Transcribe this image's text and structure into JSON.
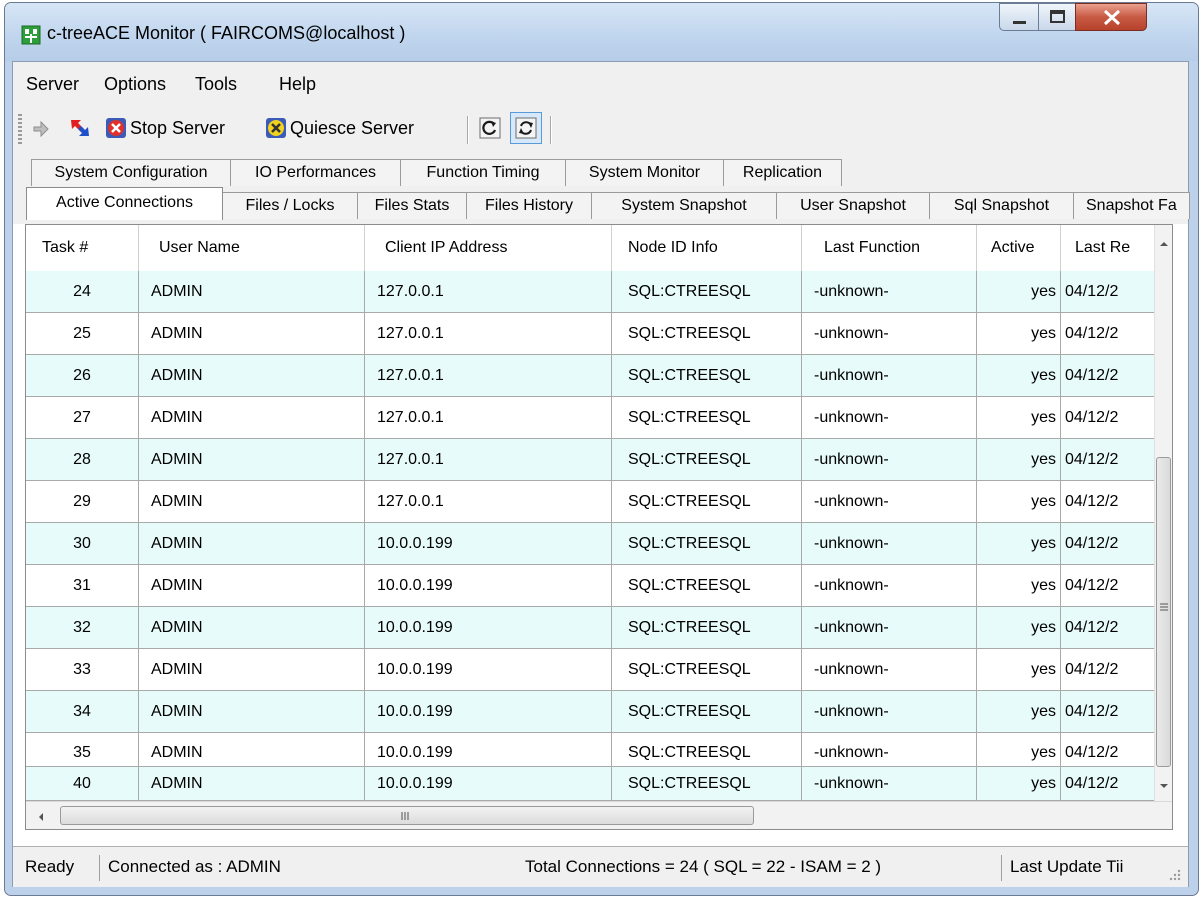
{
  "window": {
    "title": "c-treeACE Monitor ( FAIRCOMS@localhost )",
    "accent": "#bdd2ea"
  },
  "menu": [
    "Server",
    "Options",
    "Tools",
    "Help"
  ],
  "toolbar": {
    "stop_label": "Stop Server",
    "quiesce_label": "Quiesce Server",
    "icons": [
      "connect-icon",
      "disconnect-icon",
      "stop-server-icon",
      "quiesce-server-icon",
      "refresh-icon",
      "auto-refresh-icon"
    ]
  },
  "tabs": {
    "row1": [
      "System Configuration",
      "IO Performances",
      "Function Timing",
      "System Monitor",
      "Replication"
    ],
    "row2": [
      "Active Connections",
      "Files / Locks",
      "Files Stats",
      "Files History",
      "System Snapshot",
      "User Snapshot",
      "Sql Snapshot",
      "Snapshot Fa"
    ],
    "selected": "Active Connections"
  },
  "grid": {
    "columns": [
      "Task #",
      "User Name",
      "Client IP Address",
      "Node ID Info",
      "Last Function",
      "Active",
      "Last Re"
    ],
    "rows": [
      [
        "24",
        "ADMIN",
        "127.0.0.1",
        "SQL:CTREESQL",
        "-unknown-",
        "yes",
        "04/12/2"
      ],
      [
        "25",
        "ADMIN",
        "127.0.0.1",
        "SQL:CTREESQL",
        "-unknown-",
        "yes",
        "04/12/2"
      ],
      [
        "26",
        "ADMIN",
        "127.0.0.1",
        "SQL:CTREESQL",
        "-unknown-",
        "yes",
        "04/12/2"
      ],
      [
        "27",
        "ADMIN",
        "127.0.0.1",
        "SQL:CTREESQL",
        "-unknown-",
        "yes",
        "04/12/2"
      ],
      [
        "28",
        "ADMIN",
        "127.0.0.1",
        "SQL:CTREESQL",
        "-unknown-",
        "yes",
        "04/12/2"
      ],
      [
        "29",
        "ADMIN",
        "127.0.0.1",
        "SQL:CTREESQL",
        "-unknown-",
        "yes",
        "04/12/2"
      ],
      [
        "30",
        "ADMIN",
        "10.0.0.199",
        "SQL:CTREESQL",
        "-unknown-",
        "yes",
        "04/12/2"
      ],
      [
        "31",
        "ADMIN",
        "10.0.0.199",
        "SQL:CTREESQL",
        "-unknown-",
        "yes",
        "04/12/2"
      ],
      [
        "32",
        "ADMIN",
        "10.0.0.199",
        "SQL:CTREESQL",
        "-unknown-",
        "yes",
        "04/12/2"
      ],
      [
        "33",
        "ADMIN",
        "10.0.0.199",
        "SQL:CTREESQL",
        "-unknown-",
        "yes",
        "04/12/2"
      ],
      [
        "34",
        "ADMIN",
        "10.0.0.199",
        "SQL:CTREESQL",
        "-unknown-",
        "yes",
        "04/12/2"
      ],
      [
        "35",
        "ADMIN",
        "10.0.0.199",
        "SQL:CTREESQL",
        "-unknown-",
        "yes",
        "04/12/2"
      ],
      [
        "40",
        "ADMIN",
        "10.0.0.199",
        "SQL:CTREESQL",
        "-unknown-",
        "yes",
        "04/12/2"
      ]
    ],
    "row_alt_color": "#e8fbfb"
  },
  "status": {
    "ready": "Ready",
    "connected": "Connected as : ADMIN",
    "total": "Total Connections = 24 ( SQL = 22 - ISAM = 2 )",
    "last_update": "Last Update Tii"
  }
}
